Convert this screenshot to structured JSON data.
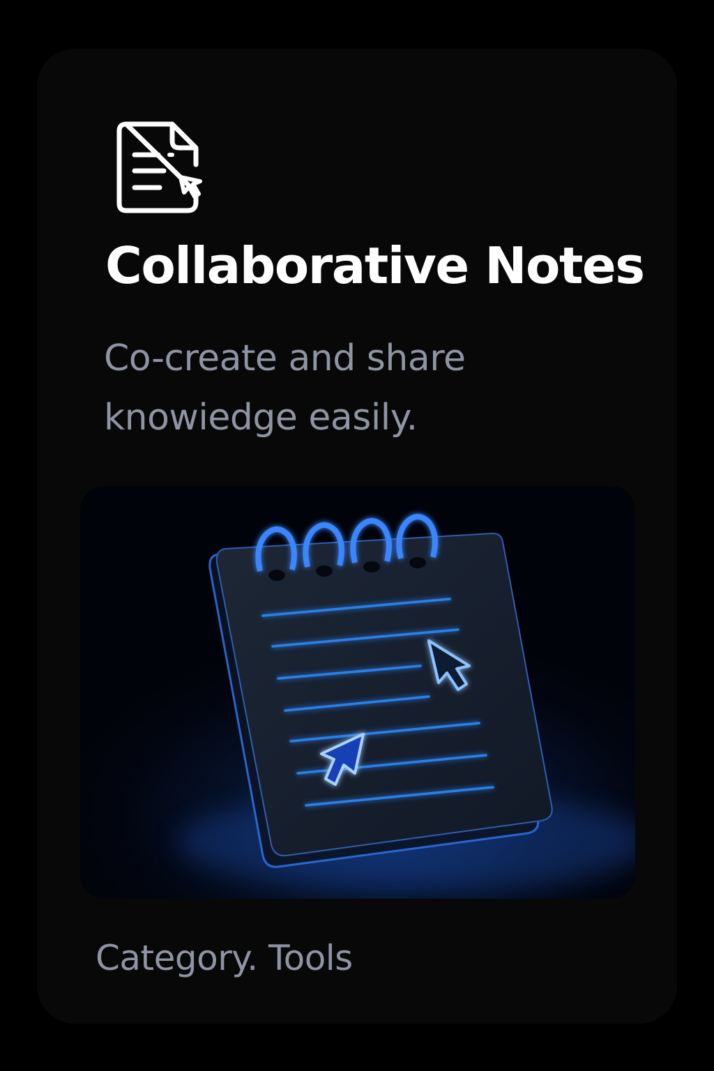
{
  "card": {
    "icon": "document-with-cursor-icon",
    "title": "Collaborative Notes",
    "description": "Co-create and share knowiedge easily.",
    "illustration": "spiral-notepad-with-cursors-icon",
    "category": "Category. Tools"
  },
  "colors": {
    "background": "#000000",
    "card": "#080808",
    "title": "#ffffff",
    "muted_text": "#8f94a3",
    "accent_glow": "#3d8bff"
  }
}
